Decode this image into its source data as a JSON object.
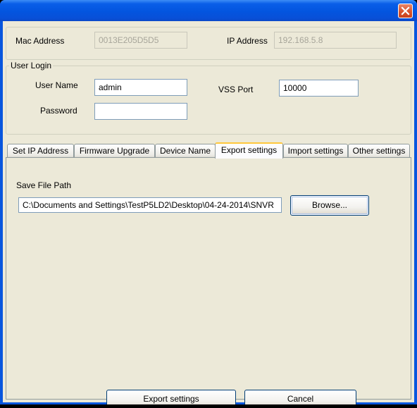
{
  "window": {
    "title": "",
    "close_icon": "close-icon",
    "colors": {
      "titlebar": "#0355df",
      "client": "#ece9d8",
      "close_button": "#d9532c",
      "active_tab_accent": "#ffc83c"
    }
  },
  "device": {
    "mac_label": "Mac Address",
    "mac_value": "0013E205D5D5",
    "ip_label": "IP Address",
    "ip_value": "192.168.5.8"
  },
  "login": {
    "group_title": "User Login",
    "username_label": "User Name",
    "username_value": "admin",
    "password_label": "Password",
    "password_value": "",
    "vss_port_label": "VSS Port",
    "vss_port_value": "10000"
  },
  "tabs": [
    {
      "label": "Set IP Address"
    },
    {
      "label": "Firmware Upgrade"
    },
    {
      "label": "Device Name"
    },
    {
      "label": "Export settings",
      "active": true
    },
    {
      "label": "Import settings"
    },
    {
      "label": "Other settings"
    }
  ],
  "export_panel": {
    "path_label": "Save File Path",
    "path_value": "C:\\Documents and Settings\\TestP5LD2\\Desktop\\04-24-2014\\SNVR",
    "browse_label": "Browse..."
  },
  "footer": {
    "export_label": "Export settings",
    "cancel_label": "Cancel"
  }
}
